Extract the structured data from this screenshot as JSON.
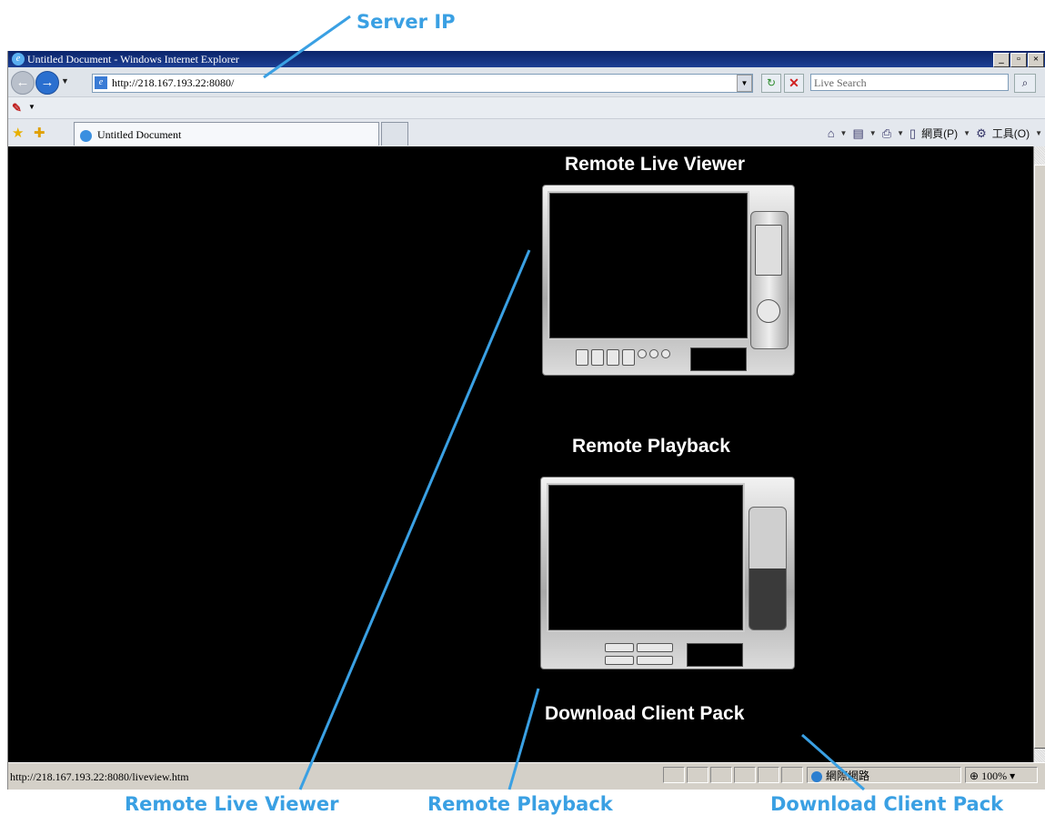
{
  "annotations": {
    "server_ip": "Server IP",
    "remote_live_viewer": "Remote Live Viewer",
    "remote_playback": "Remote Playback",
    "download_client_pack": "Download Client Pack",
    "accent_color": "#3aa0e3"
  },
  "window": {
    "title": "Untitled Document - Windows Internet Explorer",
    "buttons": [
      "_",
      "▫",
      "×"
    ]
  },
  "address_bar": {
    "url": "http://218.167.193.22:8080/",
    "search_placeholder": "Live Search"
  },
  "favorites_bar": {
    "tab_label": "Untitled Document",
    "page_menu": "網頁(P)",
    "tools_menu": "工具(O)"
  },
  "page": {
    "background": "#000000",
    "sections": [
      {
        "title": "Remote Live Viewer"
      },
      {
        "title": "Remote Playback"
      },
      {
        "title": "Download Client Pack"
      }
    ]
  },
  "status_bar": {
    "text": "http://218.167.193.22:8080/liveview.htm",
    "zone": "網際網路",
    "zoom": "100%"
  }
}
